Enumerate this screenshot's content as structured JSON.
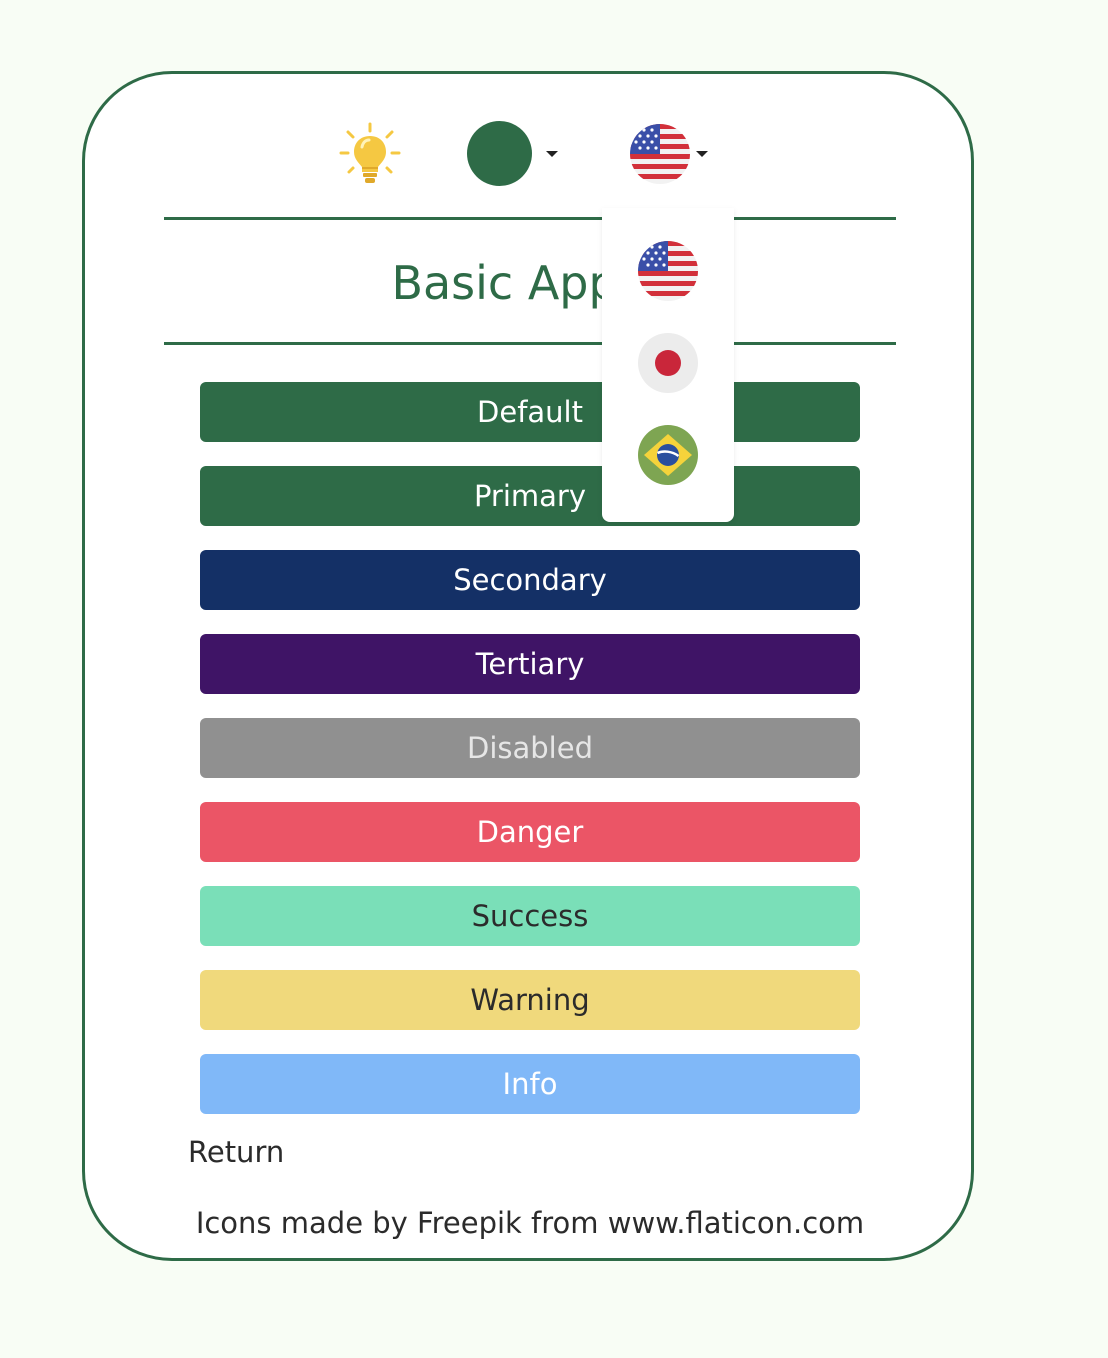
{
  "header": {
    "theme_toggle_icon": "lightbulb-icon",
    "theme_color": "#2e6b47",
    "current_language_flag": "us-flag-icon"
  },
  "title": "Basic Applic",
  "language_menu": {
    "options": [
      {
        "icon": "us-flag-icon"
      },
      {
        "icon": "japan-flag-icon"
      },
      {
        "icon": "brazil-flag-icon"
      }
    ]
  },
  "buttons": {
    "default": {
      "label": "Default",
      "bg": "#2e6b47",
      "color": "#ffffff"
    },
    "primary": {
      "label": "Primary",
      "bg": "#2e6b47",
      "color": "#ffffff"
    },
    "secondary": {
      "label": "Secondary",
      "bg": "#143066",
      "color": "#ffffff"
    },
    "tertiary": {
      "label": "Tertiary",
      "bg": "#3f1466",
      "color": "#ffffff"
    },
    "disabled": {
      "label": "Disabled",
      "bg": "#909090",
      "color": "#e6e6e6"
    },
    "danger": {
      "label": "Danger",
      "bg": "#eb5566",
      "color": "#ffffff"
    },
    "success": {
      "label": "Success",
      "bg": "#7adfb8",
      "color": "#2b2b2b"
    },
    "warning": {
      "label": "Warning",
      "bg": "#f0d97c",
      "color": "#2b2b2b"
    },
    "info": {
      "label": "Info",
      "bg": "#80b8f8",
      "color": "#ffffff"
    }
  },
  "footer": {
    "return_label": "Return",
    "credits": "Icons made by Freepik from www.flaticon.com"
  }
}
